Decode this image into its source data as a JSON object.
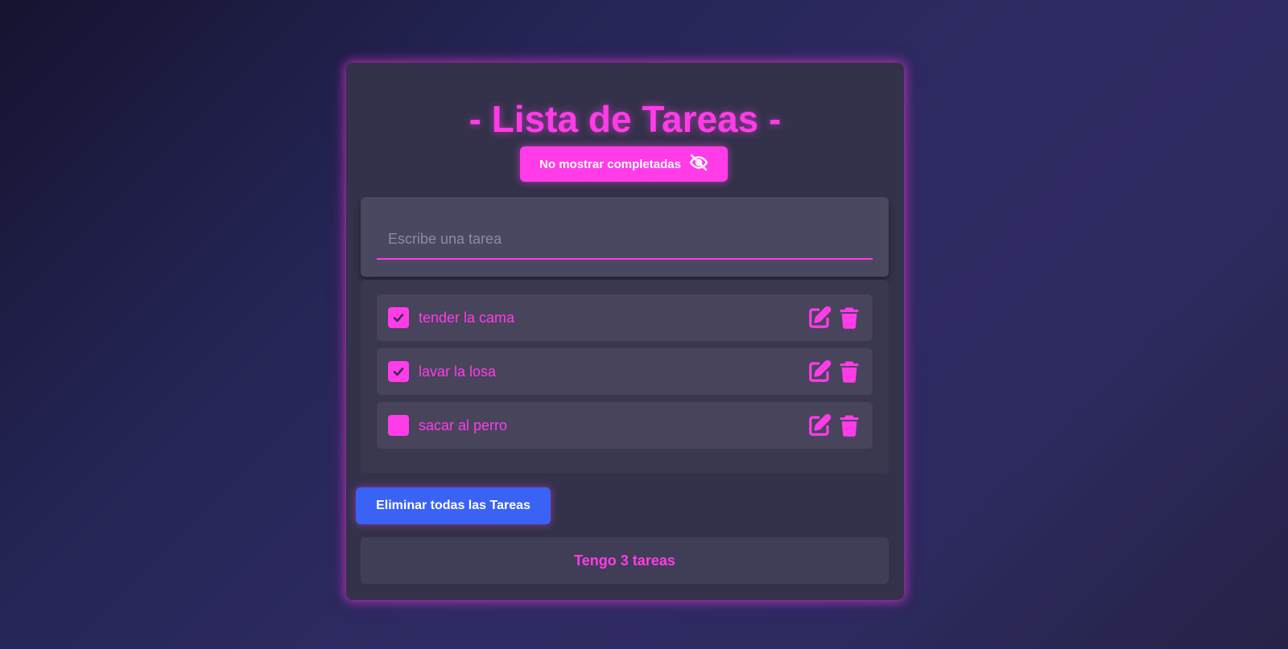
{
  "app": {
    "title": "- Lista de Tareas -",
    "accent_color": "#ff3ce8",
    "danger_button_color": "#3a62f5"
  },
  "toggle": {
    "label": "No mostrar completadas",
    "icon": "eye-slash-icon"
  },
  "input": {
    "value": "",
    "placeholder": "Escribe una tarea"
  },
  "tasks": [
    {
      "text": "tender la cama",
      "completed": true,
      "edit_icon": "pen-to-square-icon",
      "delete_icon": "trash-icon"
    },
    {
      "text": "lavar la losa",
      "completed": true,
      "edit_icon": "pen-to-square-icon",
      "delete_icon": "trash-icon"
    },
    {
      "text": "sacar al perro",
      "completed": false,
      "edit_icon": "pen-to-square-icon",
      "delete_icon": "trash-icon"
    }
  ],
  "delete_all": {
    "label": "Eliminar todas las Tareas"
  },
  "counter": {
    "text": "Tengo 3 tareas"
  }
}
